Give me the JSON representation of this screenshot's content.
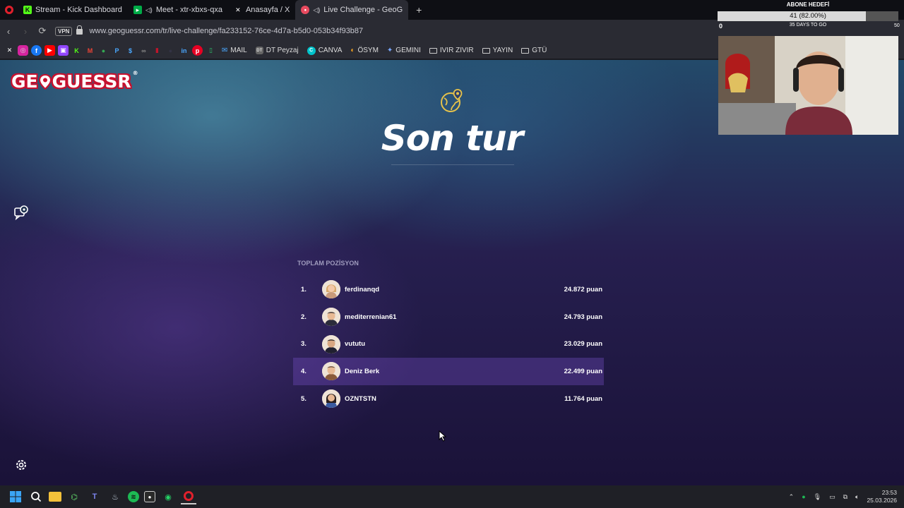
{
  "browser": {
    "tabs": [
      {
        "label": "Stream - Kick Dashboard",
        "icon": "kick-icon",
        "color": "#53fc18"
      },
      {
        "label": "Meet - xtr-xbxs-qxa",
        "icon": "meet-icon",
        "color": "#00ac47"
      },
      {
        "label": "Anasayfa / X",
        "icon": "x-icon",
        "color": "#ffffff"
      },
      {
        "label": "Live Challenge - GeoG",
        "icon": "geoguessr-pin-icon",
        "color": "#e84a5f",
        "active": true
      }
    ],
    "vpn_label": "VPN",
    "url": "www.geoguessr.com/tr/live-challenge/fa233152-76ce-4d7a-b5d0-053b34f93b87",
    "bookmarks": [
      {
        "label": "MAIL",
        "icon": "mail-icon"
      },
      {
        "label": "DT Peyzaj",
        "icon": "dt-icon"
      },
      {
        "label": "CANVA",
        "icon": "canva-icon"
      },
      {
        "label": "ÖSYM",
        "icon": "osym-icon"
      },
      {
        "label": "GEMINI",
        "icon": "gemini-icon"
      },
      {
        "label": "IVIR ZIVIR",
        "icon": "folder-icon"
      },
      {
        "label": "YAYIN",
        "icon": "folder-icon"
      },
      {
        "label": "GTÜ",
        "icon": "folder-icon"
      }
    ]
  },
  "overlay": {
    "goal_title": "ABONE HEDEFİ",
    "goal_text": "41 (82.00%)",
    "goal_fraction": 0.82,
    "goal_current": "0",
    "goal_target": "50",
    "goal_subtitle": "35 DAYS TO GO"
  },
  "page": {
    "logo": "GEOGUESSR",
    "title": "Son tur",
    "section_label": "TOPLAM POZİSYON",
    "leaderboard": [
      {
        "rank": "1.",
        "name": "ferdinanqd",
        "score": "24.872 puan",
        "avatar": "girl-avatar"
      },
      {
        "rank": "2.",
        "name": "mediterrenian61",
        "score": "24.793 puan",
        "avatar": "boy-avatar"
      },
      {
        "rank": "3.",
        "name": "vututu",
        "score": "23.029 puan",
        "avatar": "boy-avatar"
      },
      {
        "rank": "4.",
        "name": "Deniz Berk",
        "score": "22.499 puan",
        "avatar": "boy-avatar",
        "self": true
      },
      {
        "rank": "5.",
        "name": "OZNTSTN",
        "score": "11.764 puan",
        "avatar": "girl-avatar"
      }
    ]
  },
  "taskbar": {
    "time": "23:53",
    "date": "25.03.2026"
  },
  "colors": {
    "accent": "#c8102e",
    "highlight": "#7850c8",
    "globe_icon": "#e6c24a"
  }
}
